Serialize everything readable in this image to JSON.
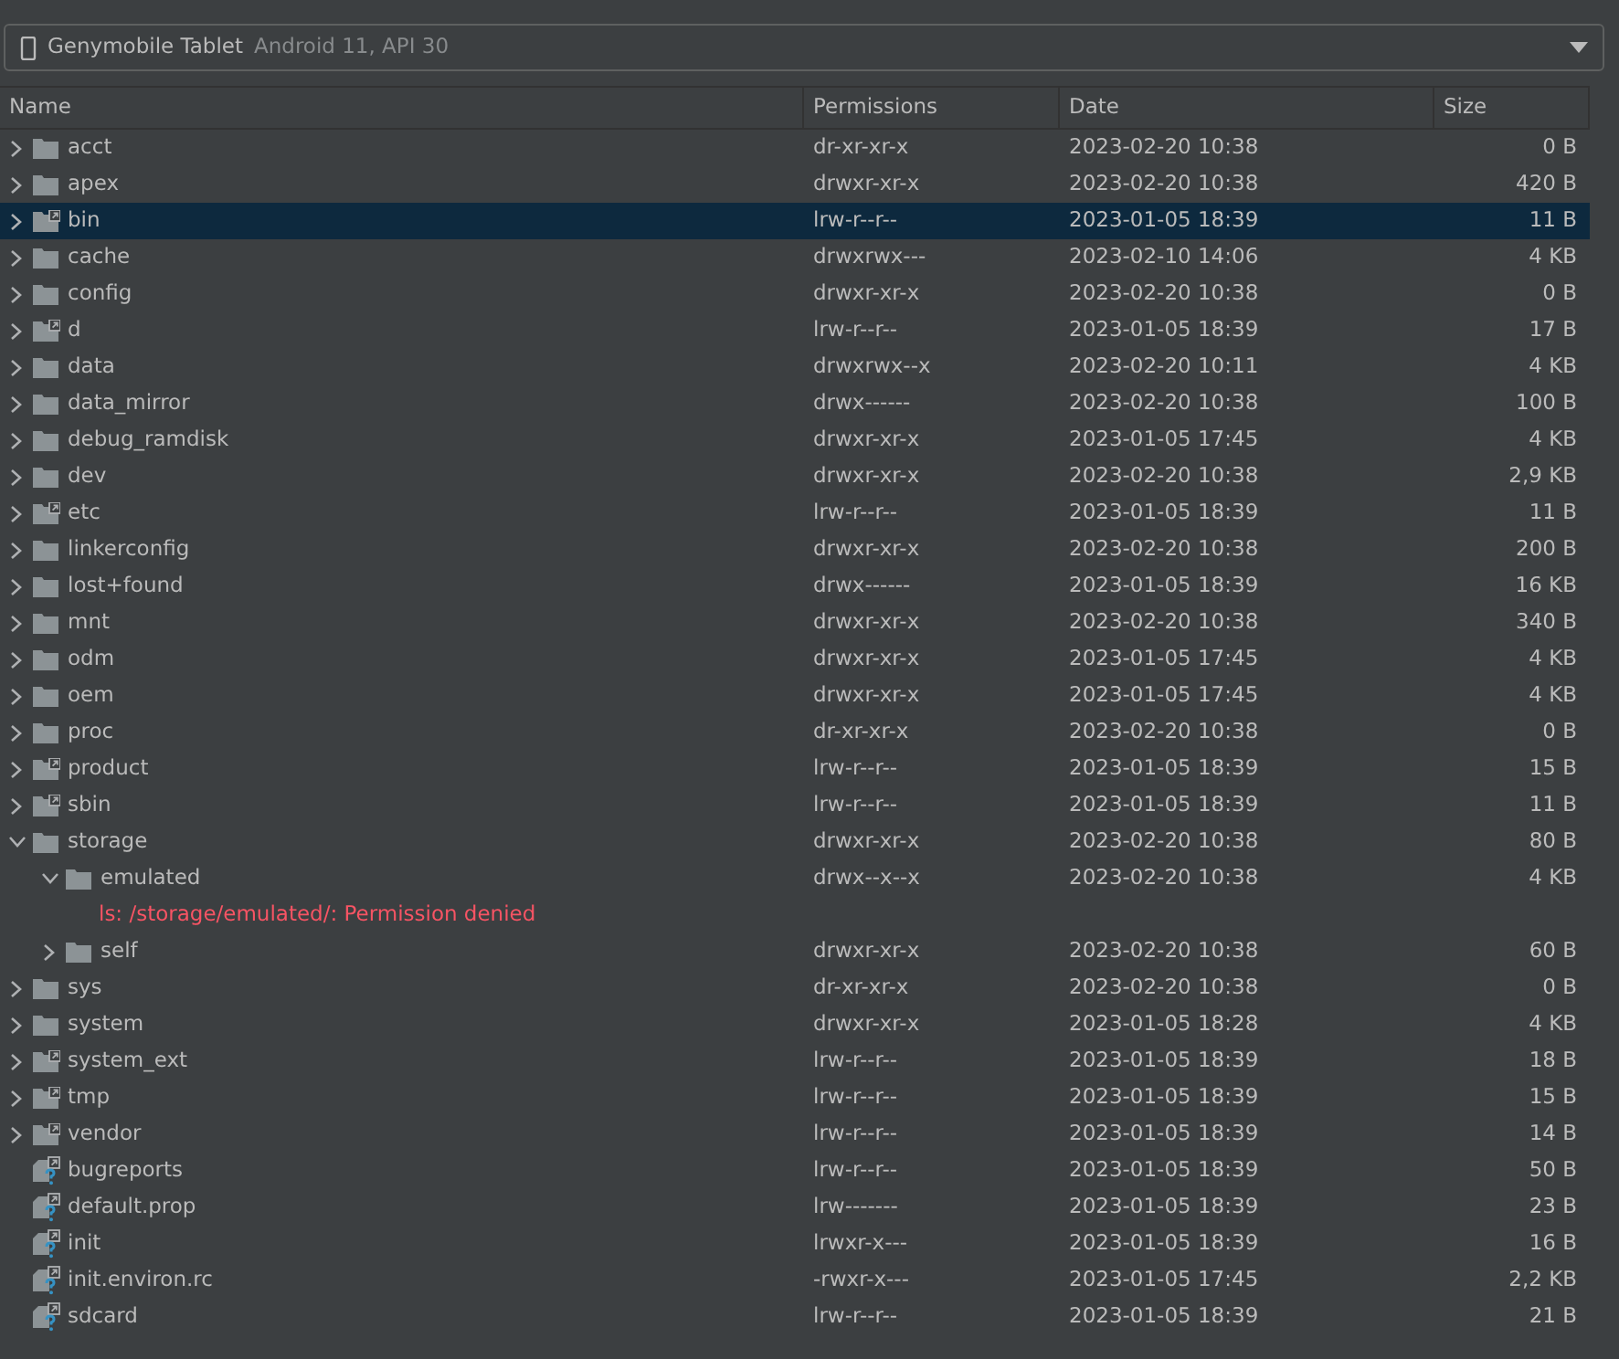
{
  "device_selector": {
    "device": "Genymobile Tablet",
    "details": "Android 11, API 30"
  },
  "table": {
    "columns": [
      "Name",
      "Permissions",
      "Date",
      "Size"
    ],
    "rows": [
      {
        "kind": "folder",
        "name": "acct",
        "permissions": "dr-xr-xr-x",
        "date": "2023-02-20 10:38",
        "size": "0 B",
        "expanded": false,
        "selected": false
      },
      {
        "kind": "folder",
        "name": "apex",
        "permissions": "drwxr-xr-x",
        "date": "2023-02-20 10:38",
        "size": "420 B",
        "expanded": false,
        "selected": false
      },
      {
        "kind": "folder-link",
        "name": "bin",
        "permissions": "lrw-r--r--",
        "date": "2023-01-05 18:39",
        "size": "11 B",
        "expanded": false,
        "selected": true
      },
      {
        "kind": "folder",
        "name": "cache",
        "permissions": "drwxrwx---",
        "date": "2023-02-10 14:06",
        "size": "4 KB",
        "expanded": false,
        "selected": false
      },
      {
        "kind": "folder",
        "name": "config",
        "permissions": "drwxr-xr-x",
        "date": "2023-02-20 10:38",
        "size": "0 B",
        "expanded": false,
        "selected": false
      },
      {
        "kind": "folder-link",
        "name": "d",
        "permissions": "lrw-r--r--",
        "date": "2023-01-05 18:39",
        "size": "17 B",
        "expanded": false,
        "selected": false
      },
      {
        "kind": "folder",
        "name": "data",
        "permissions": "drwxrwx--x",
        "date": "2023-02-20 10:11",
        "size": "4 KB",
        "expanded": false,
        "selected": false
      },
      {
        "kind": "folder",
        "name": "data_mirror",
        "permissions": "drwx------",
        "date": "2023-02-20 10:38",
        "size": "100 B",
        "expanded": false,
        "selected": false
      },
      {
        "kind": "folder",
        "name": "debug_ramdisk",
        "permissions": "drwxr-xr-x",
        "date": "2023-01-05 17:45",
        "size": "4 KB",
        "expanded": false,
        "selected": false
      },
      {
        "kind": "folder",
        "name": "dev",
        "permissions": "drwxr-xr-x",
        "date": "2023-02-20 10:38",
        "size": "2,9 KB",
        "expanded": false,
        "selected": false
      },
      {
        "kind": "folder-link",
        "name": "etc",
        "permissions": "lrw-r--r--",
        "date": "2023-01-05 18:39",
        "size": "11 B",
        "expanded": false,
        "selected": false
      },
      {
        "kind": "folder",
        "name": "linkerconfig",
        "permissions": "drwxr-xr-x",
        "date": "2023-02-20 10:38",
        "size": "200 B",
        "expanded": false,
        "selected": false
      },
      {
        "kind": "folder",
        "name": "lost+found",
        "permissions": "drwx------",
        "date": "2023-01-05 18:39",
        "size": "16 KB",
        "expanded": false,
        "selected": false
      },
      {
        "kind": "folder",
        "name": "mnt",
        "permissions": "drwxr-xr-x",
        "date": "2023-02-20 10:38",
        "size": "340 B",
        "expanded": false,
        "selected": false
      },
      {
        "kind": "folder",
        "name": "odm",
        "permissions": "drwxr-xr-x",
        "date": "2023-01-05 17:45",
        "size": "4 KB",
        "expanded": false,
        "selected": false
      },
      {
        "kind": "folder",
        "name": "oem",
        "permissions": "drwxr-xr-x",
        "date": "2023-01-05 17:45",
        "size": "4 KB",
        "expanded": false,
        "selected": false
      },
      {
        "kind": "folder",
        "name": "proc",
        "permissions": "dr-xr-xr-x",
        "date": "2023-02-20 10:38",
        "size": "0 B",
        "expanded": false,
        "selected": false
      },
      {
        "kind": "folder-link",
        "name": "product",
        "permissions": "lrw-r--r--",
        "date": "2023-01-05 18:39",
        "size": "15 B",
        "expanded": false,
        "selected": false
      },
      {
        "kind": "folder-link",
        "name": "sbin",
        "permissions": "lrw-r--r--",
        "date": "2023-01-05 18:39",
        "size": "11 B",
        "expanded": false,
        "selected": false
      },
      {
        "kind": "folder",
        "name": "storage",
        "permissions": "drwxr-xr-x",
        "date": "2023-02-20 10:38",
        "size": "80 B",
        "expanded": true,
        "selected": false,
        "children": [
          {
            "kind": "folder",
            "name": "emulated",
            "permissions": "drwx--x--x",
            "date": "2023-02-20 10:38",
            "size": "4 KB",
            "expanded": true,
            "selected": false,
            "children": [
              {
                "kind": "error",
                "name": "ls: /storage/emulated/: Permission denied",
                "selected": false
              }
            ]
          },
          {
            "kind": "folder",
            "name": "self",
            "permissions": "drwxr-xr-x",
            "date": "2023-02-20 10:38",
            "size": "60 B",
            "expanded": false,
            "selected": false
          }
        ]
      },
      {
        "kind": "folder",
        "name": "sys",
        "permissions": "dr-xr-xr-x",
        "date": "2023-02-20 10:38",
        "size": "0 B",
        "expanded": false,
        "selected": false
      },
      {
        "kind": "folder",
        "name": "system",
        "permissions": "drwxr-xr-x",
        "date": "2023-01-05 18:28",
        "size": "4 KB",
        "expanded": false,
        "selected": false
      },
      {
        "kind": "folder-link",
        "name": "system_ext",
        "permissions": "lrw-r--r--",
        "date": "2023-01-05 18:39",
        "size": "18 B",
        "expanded": false,
        "selected": false
      },
      {
        "kind": "folder-link",
        "name": "tmp",
        "permissions": "lrw-r--r--",
        "date": "2023-01-05 18:39",
        "size": "15 B",
        "expanded": false,
        "selected": false
      },
      {
        "kind": "folder-link",
        "name": "vendor",
        "permissions": "lrw-r--r--",
        "date": "2023-01-05 18:39",
        "size": "14 B",
        "expanded": false,
        "selected": false
      },
      {
        "kind": "file-link",
        "name": "bugreports",
        "permissions": "lrw-r--r--",
        "date": "2023-01-05 18:39",
        "size": "50 B",
        "selected": false
      },
      {
        "kind": "file-link",
        "name": "default.prop",
        "permissions": "lrw-------",
        "date": "2023-01-05 18:39",
        "size": "23 B",
        "selected": false
      },
      {
        "kind": "file-link",
        "name": "init",
        "permissions": "lrwxr-x---",
        "date": "2023-01-05 18:39",
        "size": "16 B",
        "selected": false
      },
      {
        "kind": "file-link",
        "name": "init.environ.rc",
        "permissions": "-rwxr-x---",
        "date": "2023-01-05 17:45",
        "size": "2,2 KB",
        "selected": false
      },
      {
        "kind": "file-link",
        "name": "sdcard",
        "permissions": "lrw-r--r--",
        "date": "2023-01-05 18:39",
        "size": "21 B",
        "selected": false
      }
    ]
  }
}
